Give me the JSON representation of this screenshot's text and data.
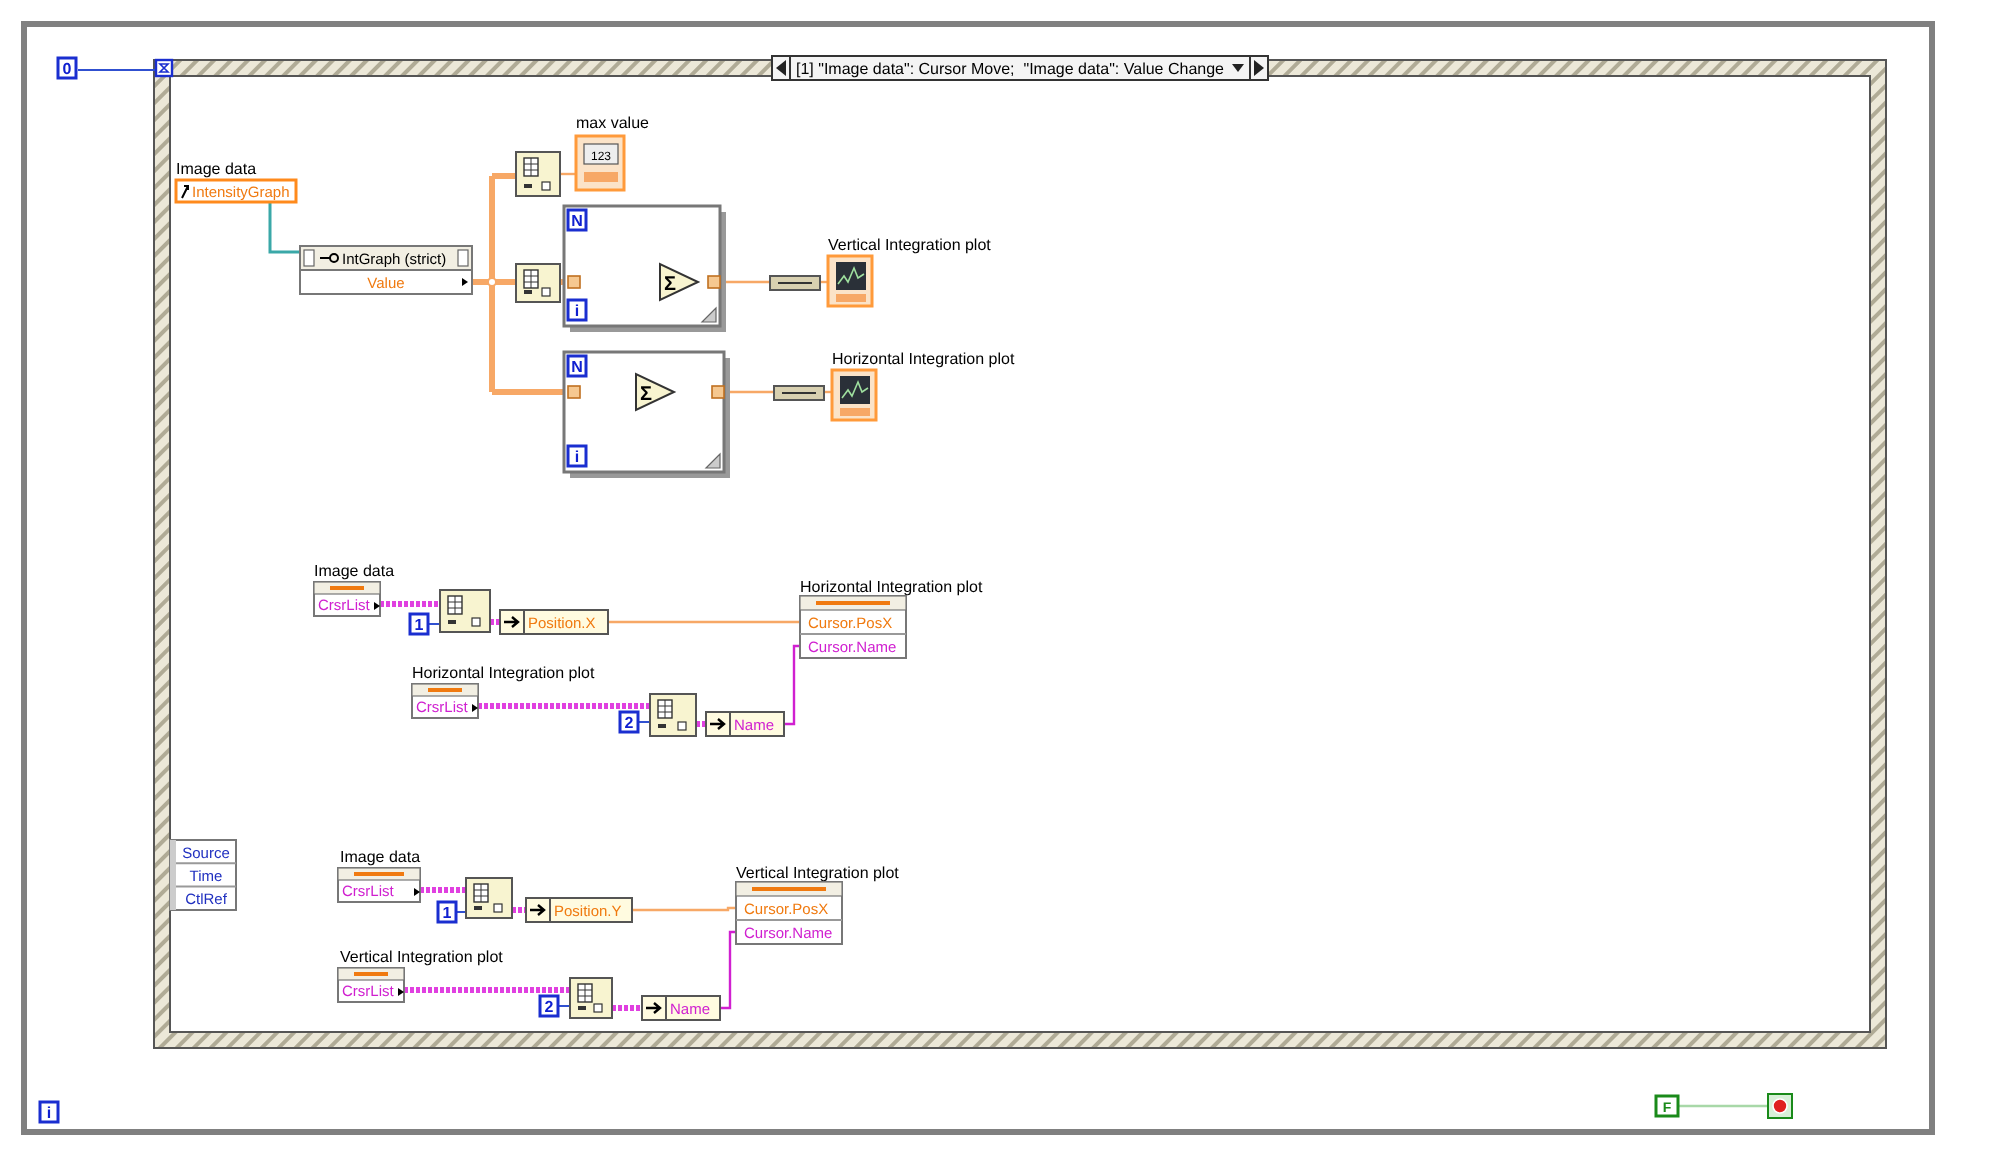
{
  "loop_count": "0",
  "event_structure": {
    "selector": "[1] \"Image data\": Cursor Move;  \"Image data\": Value Change",
    "event_data": [
      "Source",
      "Time",
      "CtlRef"
    ]
  },
  "graph_value": {
    "label": "Image data",
    "reference": "IntensityGraph",
    "class": "IntGraph (strict)",
    "property": "Value"
  },
  "max_value": {
    "label": "max value",
    "display": "123"
  },
  "for_loops": [
    {
      "count": "N",
      "index": "i",
      "sum": "Σ",
      "output_label": "Vertical Integration plot"
    },
    {
      "count": "N",
      "index": "i",
      "sum": "Σ",
      "output_label": "Horizontal Integration plot"
    }
  ],
  "cursor_blocks": [
    {
      "source": {
        "label": "Image data",
        "property": "CrsrList"
      },
      "source_index": "1",
      "position": "Position.X",
      "cursor_list": {
        "label": "Horizontal Integration plot",
        "property": "CrsrList"
      },
      "cursor_index": "2",
      "name_field": "Name",
      "target": {
        "label": "Horizontal Integration plot",
        "properties": [
          "Cursor.PosX",
          "Cursor.Name"
        ]
      }
    },
    {
      "source": {
        "label": "Image data",
        "property": "CrsrList"
      },
      "source_index": "1",
      "position": "Position.Y",
      "cursor_list": {
        "label": "Vertical Integration plot",
        "property": "CrsrList"
      },
      "cursor_index": "2",
      "name_field": "Name",
      "target": {
        "label": "Vertical Integration plot",
        "properties": [
          "Cursor.PosX",
          "Cursor.Name"
        ]
      }
    }
  ],
  "while_loop": {
    "iteration": "i",
    "stop_constant": "F"
  }
}
